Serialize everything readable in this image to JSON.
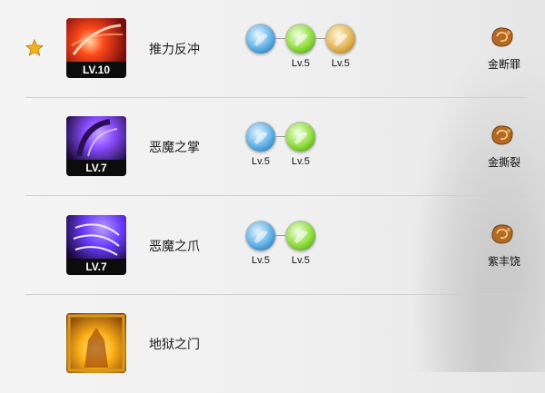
{
  "rows": [
    {
      "name": "推力反冲",
      "level": "LV.10",
      "starred": true,
      "icon": "skill-push-recoil",
      "icon_colors": [
        "#ff4a1c",
        "#7a0c0c"
      ],
      "runes": [
        {
          "icon": "blue-totem-icon",
          "level": ""
        },
        {
          "icon": "green-burst-icon",
          "level": "Lv.5"
        },
        {
          "icon": "gold-spikes-icon",
          "level": "Lv.5"
        }
      ],
      "gem": {
        "icon": "amber-gem-icon",
        "label": "金断罪"
      }
    },
    {
      "name": "恶魔之掌",
      "level": "LV.7",
      "starred": false,
      "icon": "skill-demon-palm",
      "icon_colors": [
        "#8a4dff",
        "#1a0a3a"
      ],
      "runes": [
        {
          "icon": "blue-bird-icon",
          "level": "Lv.5"
        },
        {
          "icon": "green-claw-icon",
          "level": "Lv.5"
        }
      ],
      "gem": {
        "icon": "amber-gem-icon",
        "label": "金撕裂"
      }
    },
    {
      "name": "恶魔之爪",
      "level": "LV.7",
      "starred": false,
      "icon": "skill-demon-claw",
      "icon_colors": [
        "#6b3cff",
        "#160833"
      ],
      "runes": [
        {
          "icon": "blue-swirl-icon",
          "level": "Lv.5"
        },
        {
          "icon": "green-skull-icon",
          "level": "Lv.5"
        }
      ],
      "gem": {
        "icon": "amber-gem-icon",
        "label": "紫丰饶"
      }
    },
    {
      "name": "地狱之门",
      "level": "",
      "starred": false,
      "icon": "skill-hell-gate",
      "icon_colors": [
        "#ffb21a",
        "#7a3a05"
      ],
      "runes": [],
      "gem": null
    }
  ]
}
